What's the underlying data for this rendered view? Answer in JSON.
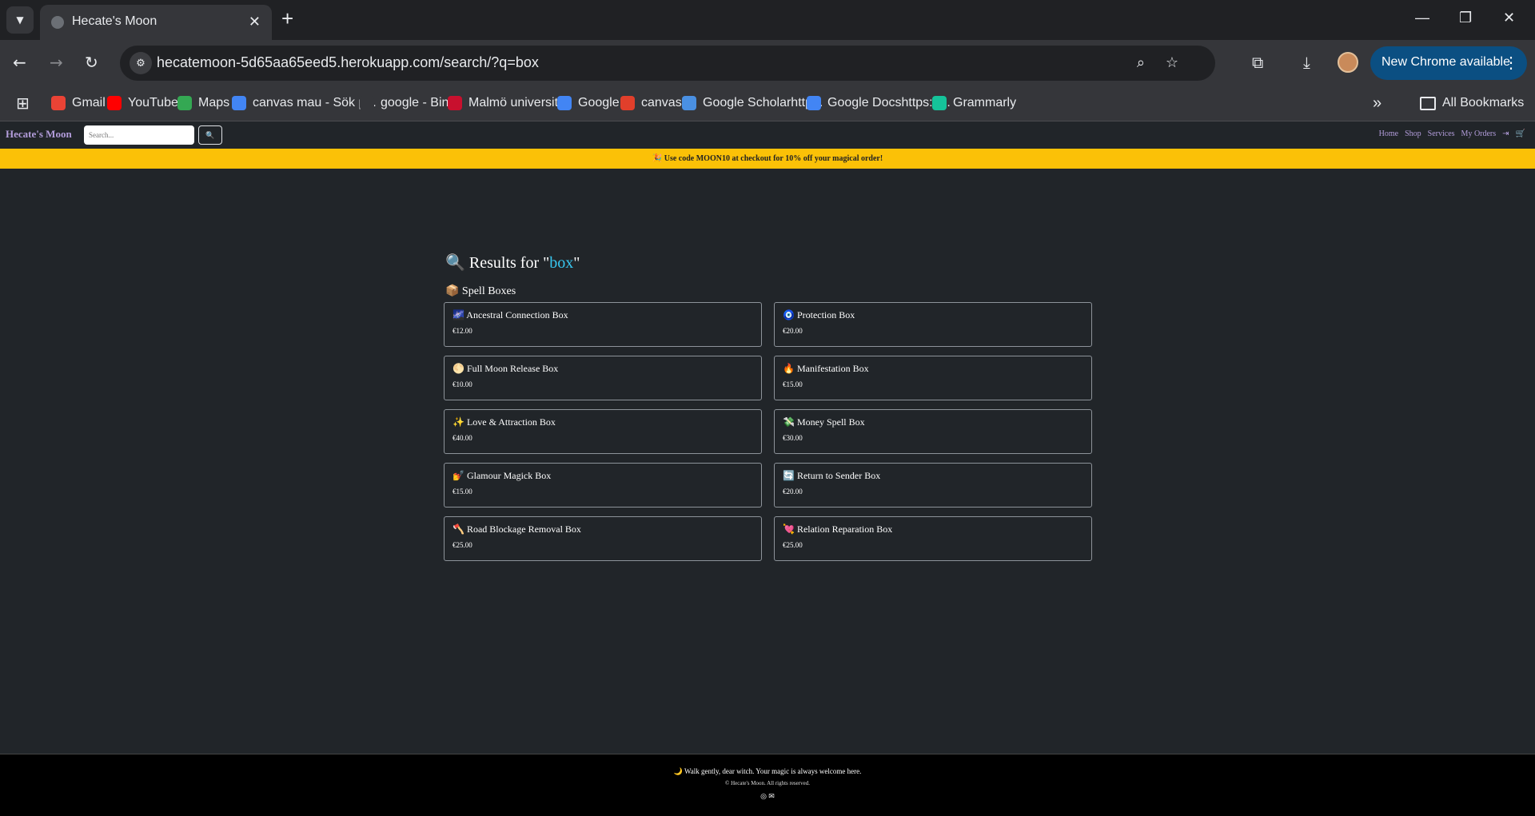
{
  "browser": {
    "tab_title": "Hecate's Moon",
    "url": "hecatemoon-5d65aa65eed5.herokuapp.com/search/?q=box",
    "update_button": "New Chrome available",
    "bookmarks": [
      {
        "label": "Gmail",
        "color": "#ea4335"
      },
      {
        "label": "YouTube",
        "color": "#ff0000"
      },
      {
        "label": "Maps",
        "color": "#34a853"
      },
      {
        "label": "canvas mau - Sök p...",
        "color": "#4285f4"
      },
      {
        "label": "google - Bing",
        "color": "#35363a"
      },
      {
        "label": "Malmö universitet",
        "color": "#c8102e"
      },
      {
        "label": "Google",
        "color": "#4285f4"
      },
      {
        "label": "canvas",
        "color": "#e13f2b"
      },
      {
        "label": "Google Scholarhttp...",
        "color": "#4a90e2"
      },
      {
        "label": "Google Docshttps://...",
        "color": "#4285f4"
      },
      {
        "label": "Grammarly",
        "color": "#15c39a"
      }
    ],
    "all_bookmarks": "All Bookmarks"
  },
  "site": {
    "brand": "Hecate's Moon",
    "search_placeholder": "Search...",
    "search_icon": "🔍",
    "nav": {
      "home": "Home",
      "shop": "Shop",
      "services": "Services",
      "orders": "My Orders"
    },
    "promo": "🎉 Use code MOON10 at checkout for 10% off your magical order!"
  },
  "results": {
    "prefix": "🔍 Results for \"",
    "query": "box",
    "suffix": "\"",
    "section": "📦 Spell Boxes",
    "items": [
      {
        "name": "🌌 Ancestral Connection Box",
        "price": "€12.00"
      },
      {
        "name": "🧿 Protection Box",
        "price": "€20.00"
      },
      {
        "name": "🌕 Full Moon Release Box",
        "price": "€10.00"
      },
      {
        "name": "🔥 Manifestation Box",
        "price": "€15.00"
      },
      {
        "name": "✨ Love & Attraction Box",
        "price": "€40.00"
      },
      {
        "name": "💸 Money Spell Box",
        "price": "€30.00"
      },
      {
        "name": "💅 Glamour Magick Box",
        "price": "€15.00"
      },
      {
        "name": "🔄 Return to Sender Box",
        "price": "€20.00"
      },
      {
        "name": "🪓 Road Blockage Removal Box",
        "price": "€25.00"
      },
      {
        "name": "💘 Relation Reparation Box",
        "price": "€25.00"
      }
    ]
  },
  "footer": {
    "tagline": "🌙 Walk gently, dear witch. Your magic is always welcome here.",
    "copyright": "© Hecate's Moon. All rights reserved.",
    "social": "◎   ✉"
  }
}
